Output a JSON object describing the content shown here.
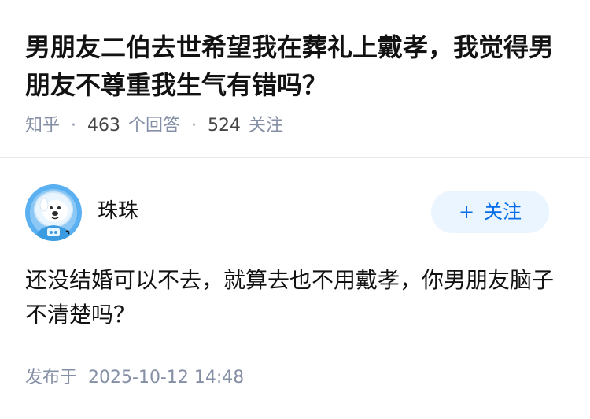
{
  "question": {
    "title": "男朋友二伯去世希望我在葬礼上戴孝，我觉得男朋友不尊重我生气有错吗？",
    "source": "知乎",
    "answer_count": "463",
    "answer_label": "个回答",
    "follower_count": "524",
    "follower_label": "关注",
    "separator": "·"
  },
  "answer": {
    "author": {
      "name": "珠珠",
      "avatar_icon": "astronaut-dog-avatar"
    },
    "follow_button": {
      "plus": "+",
      "label": "关注"
    },
    "content": "还没结婚可以不去，就算去也不用戴孝，你男朋友脑子不清楚吗？",
    "publish_label": "发布于",
    "publish_time": "2025-10-12 14:48"
  },
  "colors": {
    "accent": "#056de8",
    "follow_bg": "#ebf5ff",
    "meta_text": "#8590a6",
    "title_text": "#121212",
    "avatar_bg": "#5ab0f0"
  }
}
